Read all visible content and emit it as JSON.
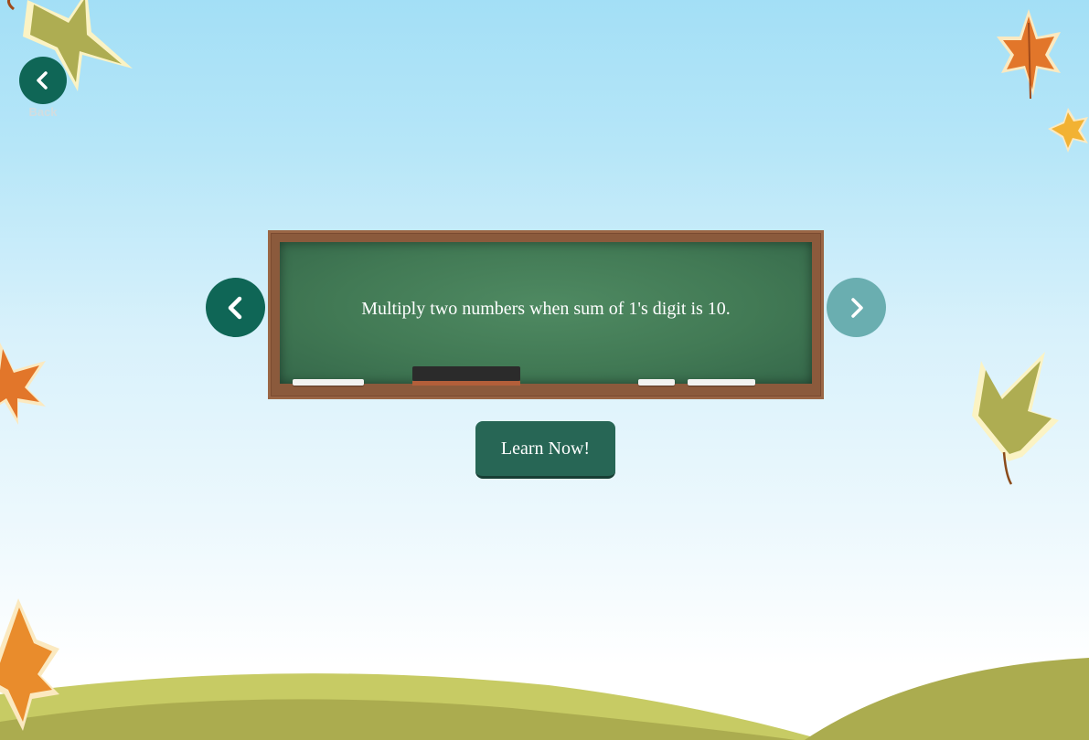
{
  "nav": {
    "back_label": "Back"
  },
  "lesson": {
    "description": "Multiply two numbers when sum of 1's digit is 10."
  },
  "actions": {
    "learn_label": "Learn Now!"
  },
  "icons": {
    "back": "chevron-left-icon",
    "prev": "chevron-left-icon",
    "next": "chevron-right-icon"
  },
  "colors": {
    "primary": "#0f6656",
    "disabled_arrow": "#6aaeb0",
    "button": "#276655",
    "chalkboard": "#427a55",
    "hill_light": "#c7cb64",
    "hill_dark": "#abac4f"
  }
}
